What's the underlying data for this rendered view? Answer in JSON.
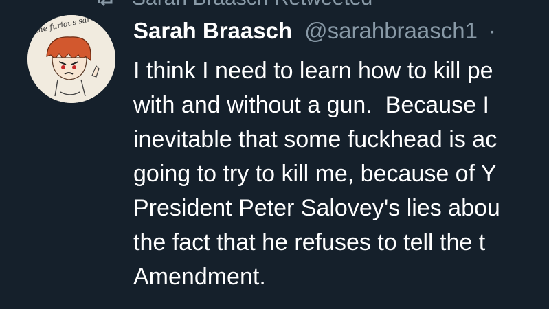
{
  "retweet": {
    "icon": "retweet-icon",
    "text": "Sarah Braasch Retweeted"
  },
  "tweet": {
    "avatar": {
      "caption": "the furious sarah",
      "icon": "cartoon-avatar"
    },
    "display_name": "Sarah Braasch",
    "handle": "@sarahbraasch1",
    "separator": "·",
    "lines": [
      "I think I need to learn how to kill pe",
      "with and without a gun.  Because I",
      "inevitable that some fuckhead is ac",
      "going to try to kill me, because of Y",
      "President Peter Salovey's lies abou",
      "the fact that he refuses to tell the t",
      "Amendment."
    ]
  },
  "colors": {
    "background": "#15202b",
    "text": "#ffffff",
    "muted": "#8899a6"
  }
}
